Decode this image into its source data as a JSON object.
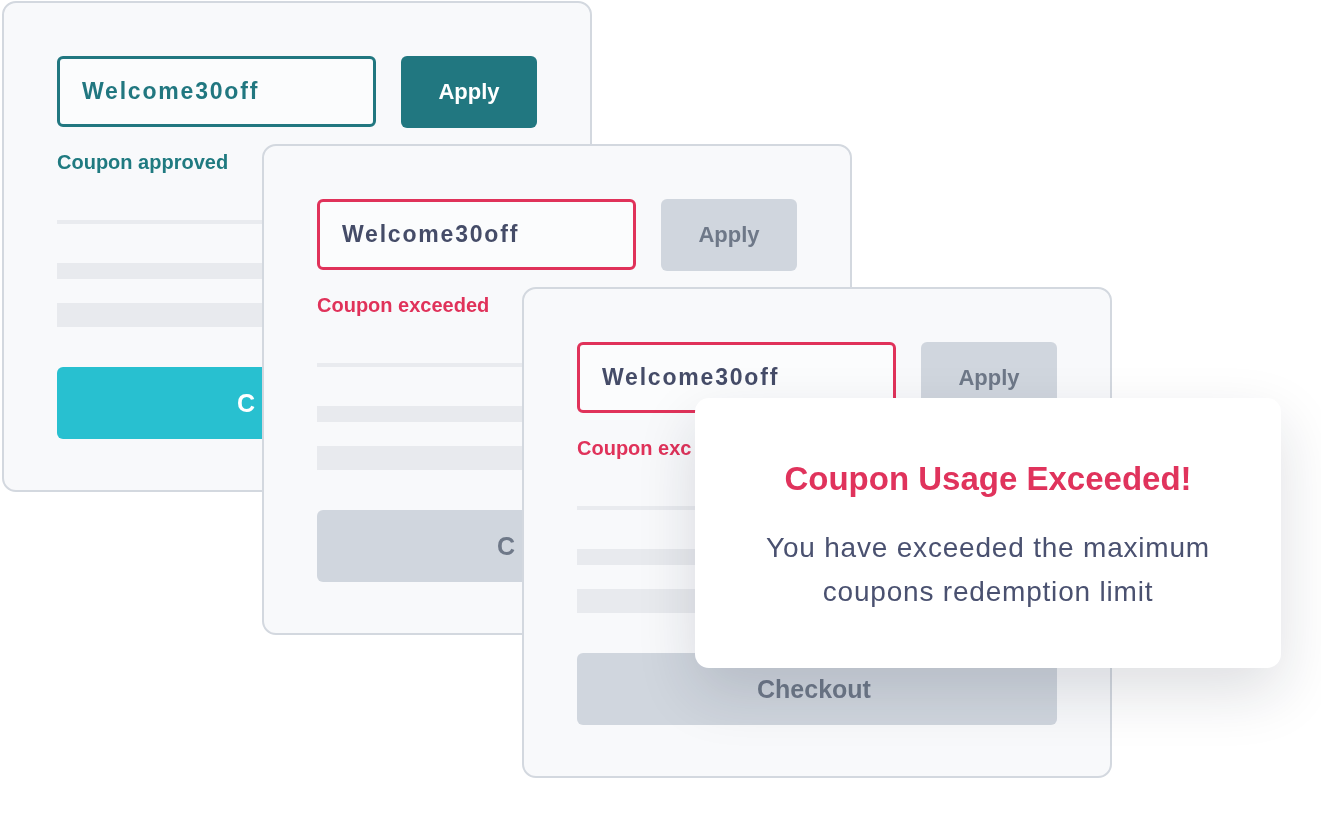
{
  "cards": [
    {
      "error": false,
      "coupon_field": {
        "value": "Welcome30off"
      },
      "apply_button": {
        "label": "Apply",
        "disabled": false
      },
      "message": "Coupon approved",
      "checkout_button": {
        "label": "C",
        "disabled": false
      }
    },
    {
      "error": true,
      "coupon_field": {
        "value": "Welcome30off"
      },
      "apply_button": {
        "label": "Apply",
        "disabled": true
      },
      "message": "Coupon exceeded",
      "checkout_button": {
        "label": "C",
        "disabled": true
      }
    },
    {
      "error": true,
      "coupon_field": {
        "value": "Welcome30off"
      },
      "apply_button": {
        "label": "Apply",
        "disabled": true
      },
      "message": "Coupon exc",
      "checkout_button": {
        "label": "Checkout",
        "disabled": true
      }
    }
  ],
  "dialog": {
    "title": "Coupon Usage Exceeded!",
    "message": "You have exceeded the maximum coupons redemption limit"
  }
}
